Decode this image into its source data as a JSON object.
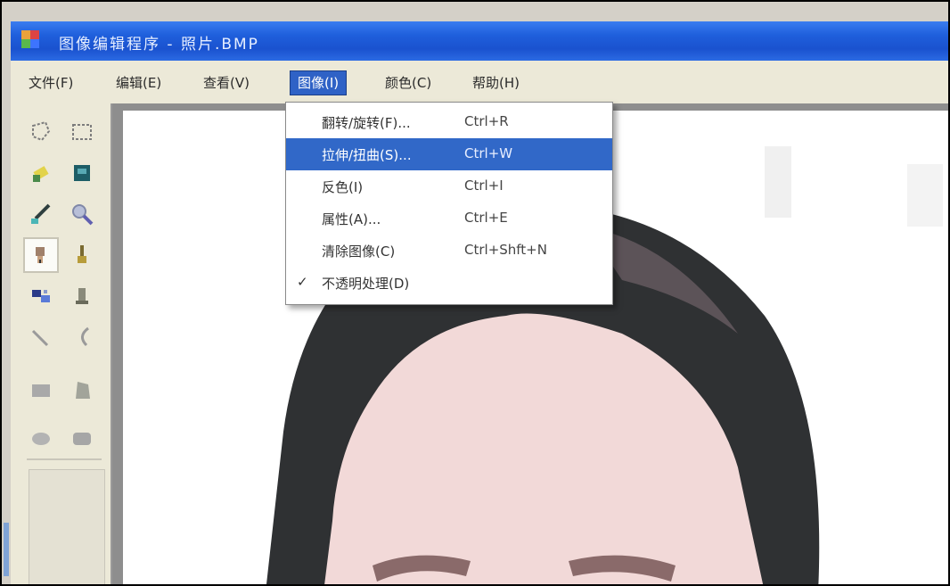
{
  "window": {
    "title": "图像编辑程序 - 照片.BMP"
  },
  "menubar": {
    "items": [
      {
        "label": "文件(F)"
      },
      {
        "label": "编辑(E)"
      },
      {
        "label": "查看(V)"
      },
      {
        "label": "图像(I)"
      },
      {
        "label": "颜色(C)"
      },
      {
        "label": "帮助(H)"
      }
    ],
    "active_index": 3
  },
  "dropdown": {
    "items": [
      {
        "label": "翻转/旋转(F)...",
        "shortcut": "Ctrl+R",
        "checked": false
      },
      {
        "label": "拉伸/扭曲(S)...",
        "shortcut": "Ctrl+W",
        "checked": false
      },
      {
        "label": "反色(I)",
        "shortcut": "Ctrl+I",
        "checked": false
      },
      {
        "label": "属性(A)...",
        "shortcut": "Ctrl+E",
        "checked": false
      },
      {
        "label": "清除图像(C)",
        "shortcut": "Ctrl+Shft+N",
        "checked": false
      },
      {
        "label": "不透明处理(D)",
        "shortcut": "",
        "checked": true
      }
    ],
    "highlight_index": 1,
    "check_glyph": "✓"
  },
  "toolbox": {
    "tools": [
      {
        "name": "free-select-icon"
      },
      {
        "name": "rect-select-icon"
      },
      {
        "name": "eraser-icon"
      },
      {
        "name": "fill-icon"
      },
      {
        "name": "color-picker-icon"
      },
      {
        "name": "magnifier-icon"
      },
      {
        "name": "pencil-icon"
      },
      {
        "name": "brush-icon"
      },
      {
        "name": "airbrush-icon"
      },
      {
        "name": "text-icon"
      },
      {
        "name": "line-icon"
      },
      {
        "name": "curve-icon"
      },
      {
        "name": "rectangle-icon"
      },
      {
        "name": "polygon-icon"
      },
      {
        "name": "ellipse-icon"
      },
      {
        "name": "rounded-rect-icon"
      }
    ],
    "selected_index": 6
  },
  "colors": {
    "titlebar": "#1f5fdc",
    "menubar": "#ece9d8",
    "highlight": "#3168c8",
    "hair": "#2f3133",
    "skin": "#f2dad8"
  }
}
